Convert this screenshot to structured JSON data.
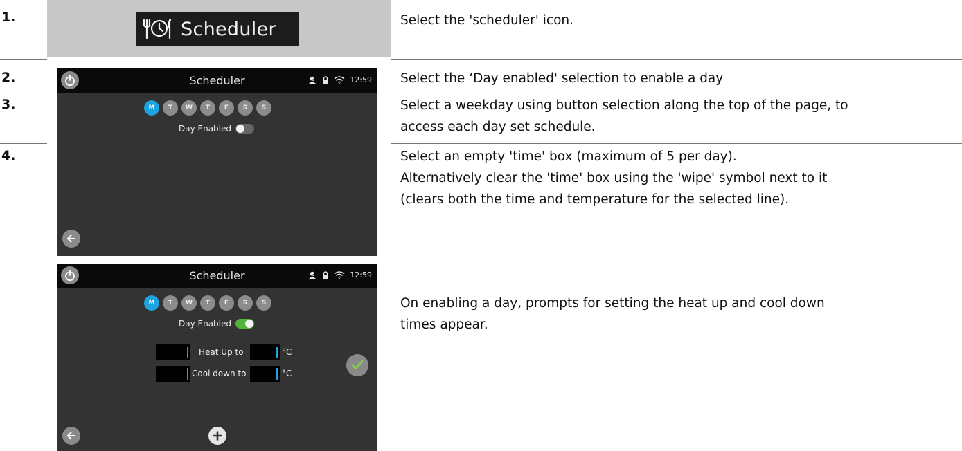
{
  "steps": [
    {
      "number": "1.",
      "text": [
        "Select the 'scheduler' icon."
      ]
    },
    {
      "number": "2.",
      "text": [
        "Select the ‘Day enabled' selection to enable a day"
      ]
    },
    {
      "number": "3.",
      "text": [
        "Select a weekday using button selection along the top of the page, to",
        "access each day set schedule."
      ]
    },
    {
      "number": "4.",
      "text": [
        "Select an empty 'time' box (maximum of 5 per day).",
        "Alternatively clear the 'time' box using the 'wipe' symbol next to it",
        "(clears both the time and temperature for the selected line)."
      ]
    }
  ],
  "extra_note": [
    "On enabling a day, prompts for setting the heat up and cool down",
    "times appear."
  ],
  "scheduler_button": {
    "label": "Scheduler",
    "icon": "cutlery-clock-icon"
  },
  "screen1": {
    "title": "Scheduler",
    "time": "12:59",
    "days": [
      "M",
      "T",
      "W",
      "T",
      "F",
      "S",
      "S"
    ],
    "active_day_index": 0,
    "day_enabled_label": "Day Enabled",
    "day_enabled": false
  },
  "screen2": {
    "title": "Scheduler",
    "time": "12:59",
    "days": [
      "M",
      "T",
      "W",
      "T",
      "F",
      "S",
      "S"
    ],
    "active_day_index": 0,
    "day_enabled_label": "Day Enabled",
    "day_enabled": true,
    "heat_up_label": "Heat Up to",
    "cool_down_label": "Cool down to",
    "unit": "°C"
  },
  "colors": {
    "accent_blue": "#1fa3e0",
    "toggle_green": "#52b43a",
    "confirm_check": "#7cd444"
  }
}
